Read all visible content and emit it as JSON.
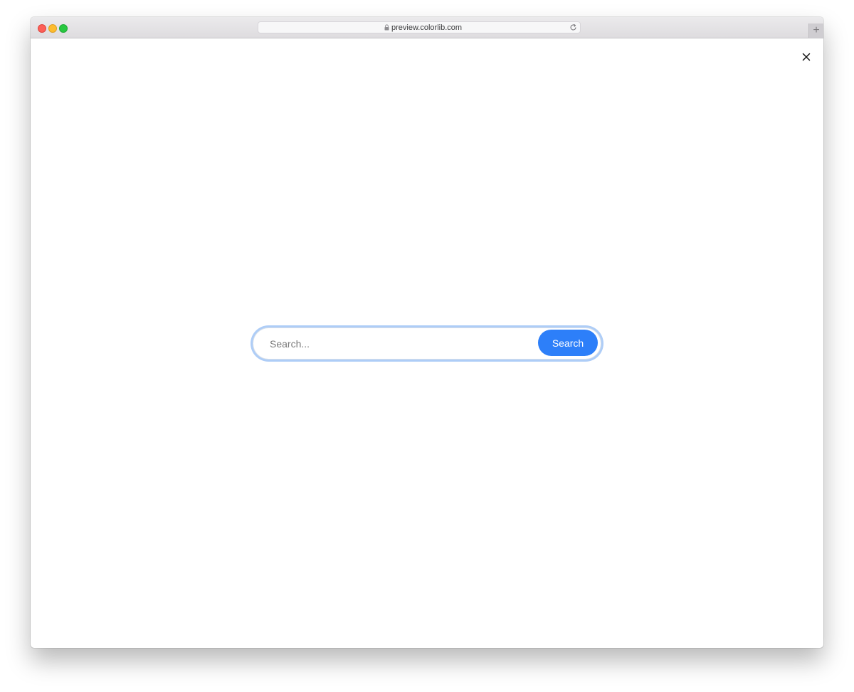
{
  "browser": {
    "url": "preview.colorlib.com",
    "new_tab_label": "+"
  },
  "search": {
    "placeholder": "Search...",
    "value": "",
    "button_label": "Search"
  },
  "colors": {
    "accent": "#2d7ff9",
    "focus_ring": "#aecdf7"
  },
  "icons": {
    "close": "close-icon",
    "lock": "lock-icon",
    "reload": "reload-icon"
  }
}
